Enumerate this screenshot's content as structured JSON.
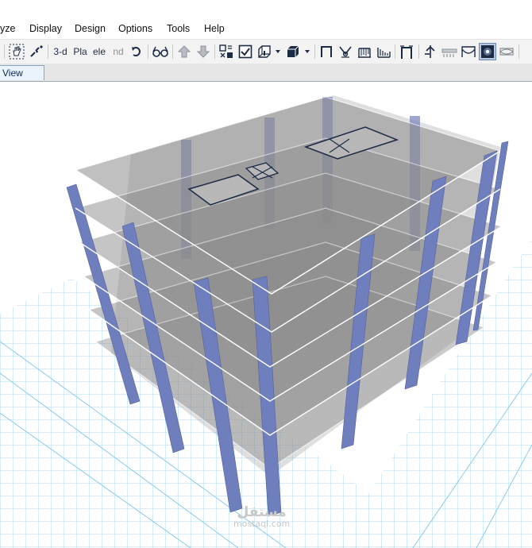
{
  "menu": {
    "items": [
      "yze",
      "Display",
      "Design",
      "Options",
      "Tools",
      "Help"
    ]
  },
  "toolbar": {
    "view_3d": "3-d",
    "view_plan": "Pla",
    "view_elev": "ele",
    "view_nd": "nd"
  },
  "tabs": {
    "active": "View"
  },
  "watermark": {
    "arabic": "مستقل",
    "latin": "mostaql.com"
  },
  "colors": {
    "grid": "#9fd0f0",
    "column": "#6f7ebd",
    "slab": "#8c8c8c",
    "toolbar_icon": "#1c2b44"
  }
}
